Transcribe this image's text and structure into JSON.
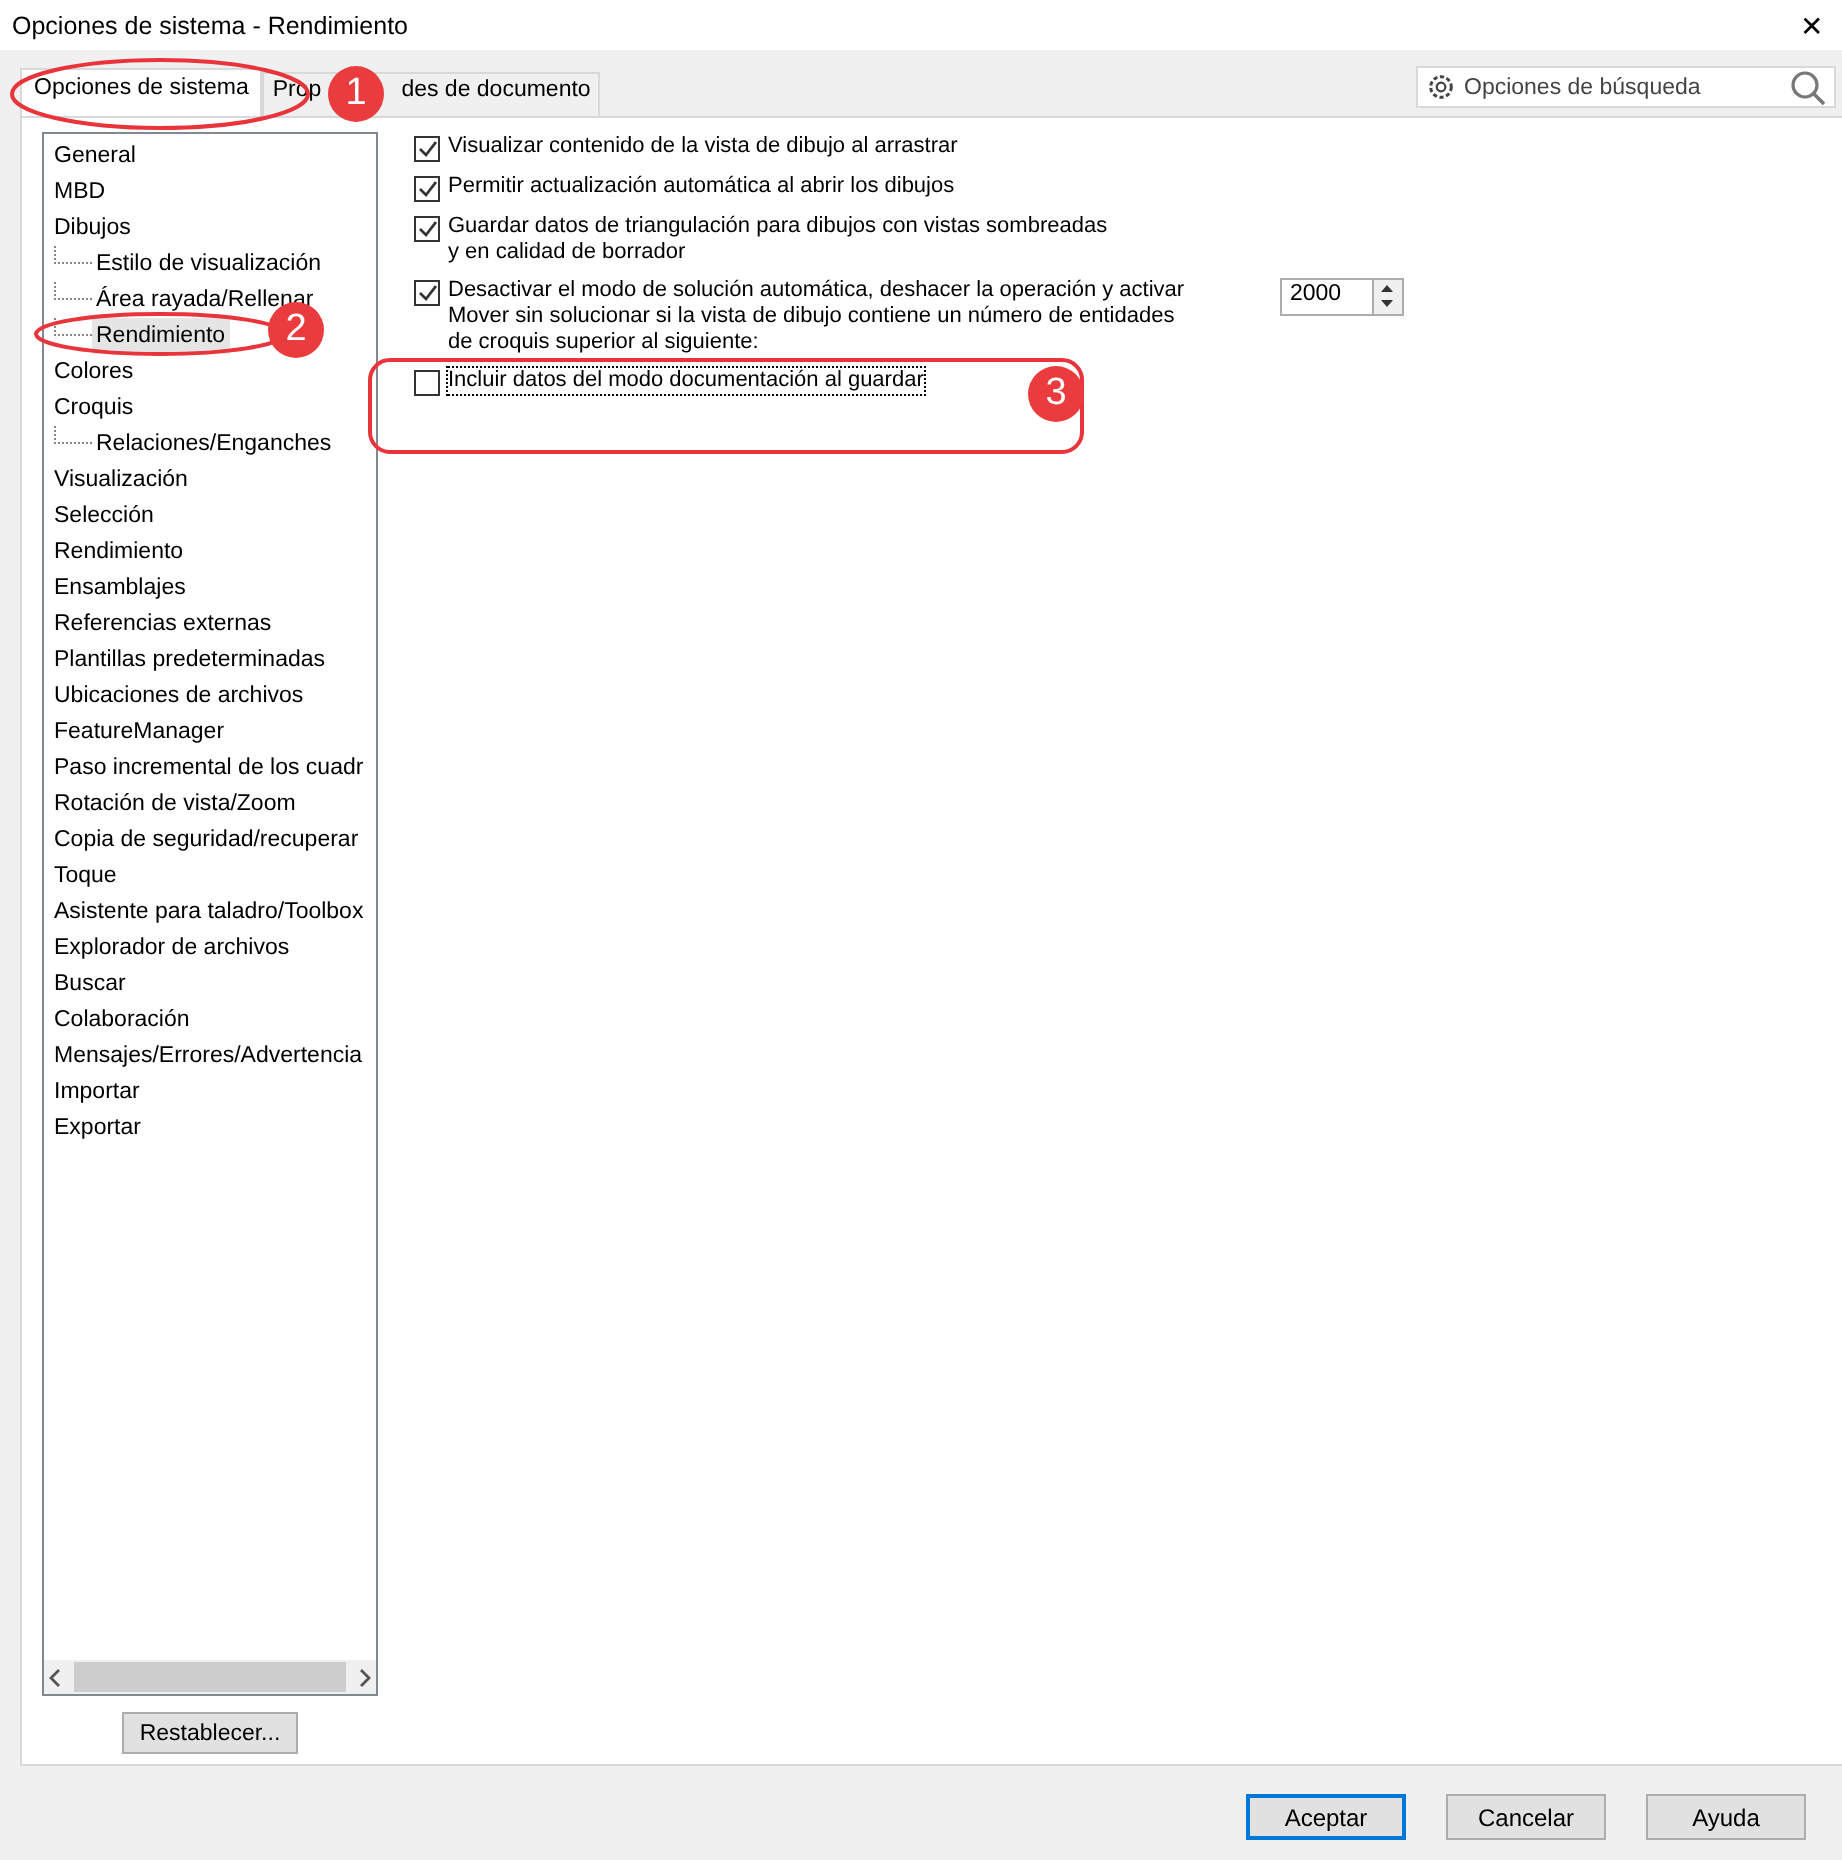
{
  "window": {
    "title": "Opciones de sistema - Rendimiento",
    "close": "✕"
  },
  "tabs": [
    {
      "label": "Opciones de sistema",
      "selected": true
    },
    {
      "label": "Prop",
      "label_after": "des de documento",
      "selected": false
    }
  ],
  "search": {
    "placeholder": "Opciones de búsqueda"
  },
  "tree": [
    {
      "label": "General",
      "selected": false
    },
    {
      "label": "MBD",
      "selected": false
    },
    {
      "label": "Dibujos",
      "selected": false,
      "children": [
        {
          "label": "Estilo de visualización",
          "selected": false
        },
        {
          "label": "Área rayada/Rellenar",
          "selected": false
        },
        {
          "label": "Rendimiento",
          "selected": true
        }
      ]
    },
    {
      "label": "Colores",
      "selected": false
    },
    {
      "label": "Croquis",
      "selected": false,
      "children": [
        {
          "label": "Relaciones/Enganches",
          "selected": false
        }
      ]
    },
    {
      "label": "Visualización",
      "selected": false
    },
    {
      "label": "Selección",
      "selected": false
    },
    {
      "label": "Rendimiento",
      "selected": false
    },
    {
      "label": "Ensamblajes",
      "selected": false
    },
    {
      "label": "Referencias externas",
      "selected": false
    },
    {
      "label": "Plantillas predeterminadas",
      "selected": false
    },
    {
      "label": "Ubicaciones de archivos",
      "selected": false
    },
    {
      "label": "FeatureManager",
      "selected": false
    },
    {
      "label": "Paso incremental de los cuadr",
      "selected": false
    },
    {
      "label": "Rotación de vista/Zoom",
      "selected": false
    },
    {
      "label": "Copia de seguridad/recuperar",
      "selected": false
    },
    {
      "label": "Toque",
      "selected": false
    },
    {
      "label": "Asistente para taladro/Toolbox",
      "selected": false
    },
    {
      "label": "Explorador de archivos",
      "selected": false
    },
    {
      "label": "Buscar",
      "selected": false
    },
    {
      "label": "Colaboración",
      "selected": false
    },
    {
      "label": "Mensajes/Errores/Advertencia",
      "selected": false
    },
    {
      "label": "Importar",
      "selected": false
    },
    {
      "label": "Exportar",
      "selected": false
    }
  ],
  "reset_button": "Restablecer...",
  "options": [
    {
      "kind": "check",
      "lines": [
        "Visualizar contenido de la vista de dibujo al arrastrar"
      ],
      "checked": true,
      "focused": false
    },
    {
      "kind": "check",
      "lines": [
        "Permitir actualización automática al abrir los dibujos"
      ],
      "checked": true,
      "focused": false
    },
    {
      "kind": "check",
      "lines": [
        "Guardar datos de triangulación para dibujos con vistas sombreadas",
        "y en calidad de borrador"
      ],
      "checked": true,
      "focused": false
    },
    {
      "kind": "check_number",
      "lines": [
        "Desactivar el modo de solución automática, deshacer la operación y activar",
        "Mover sin solucionar si la vista de dibujo contiene un número de entidades",
        "de croquis superior al siguiente:"
      ],
      "checked": true,
      "focused": false,
      "value": "2000"
    },
    {
      "kind": "check",
      "lines": [
        "Incluir datos del modo documentación al guardar"
      ],
      "checked": false,
      "focused": true
    }
  ],
  "buttons": [
    {
      "label": "Aceptar",
      "default": true
    },
    {
      "label": "Cancelar",
      "default": false
    },
    {
      "label": "Ayuda",
      "default": false
    }
  ],
  "annotations": [
    {
      "number": "1"
    },
    {
      "number": "2"
    },
    {
      "number": "3"
    }
  ]
}
